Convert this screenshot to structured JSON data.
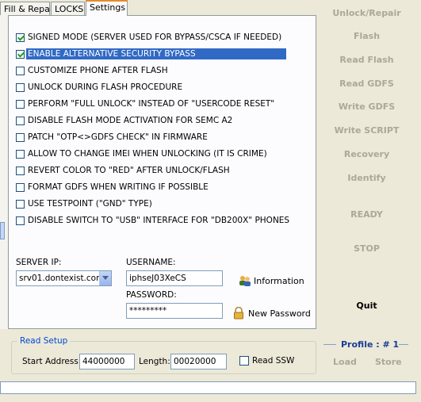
{
  "tabs": [
    {
      "label": "Fill & Repair",
      "active": false
    },
    {
      "label": "LOCKS",
      "active": false
    },
    {
      "label": "Settings",
      "active": true
    }
  ],
  "options": [
    {
      "label": "SIGNED MODE (SERVER USED FOR BYPASS/CSCA IF NEEDED)",
      "checked": true,
      "selected": false
    },
    {
      "label": "ENABLE ALTERNATIVE SECURITY BYPASS",
      "checked": true,
      "selected": true
    },
    {
      "label": "CUSTOMIZE PHONE AFTER FLASH",
      "checked": false,
      "selected": false
    },
    {
      "label": "UNLOCK DURING FLASH PROCEDURE",
      "checked": false,
      "selected": false
    },
    {
      "label": "PERFORM \"FULL UNLOCK\" INSTEAD OF \"USERCODE RESET\"",
      "checked": false,
      "selected": false
    },
    {
      "label": "DISABLE FLASH MODE ACTIVATION FOR SEMC A2",
      "checked": false,
      "selected": false
    },
    {
      "label": "PATCH \"OTP<>GDFS CHECK\" IN FIRMWARE",
      "checked": false,
      "selected": false
    },
    {
      "label": "ALLOW TO CHANGE IMEI WHEN UNLOCKING (IT IS CRIME)",
      "checked": false,
      "selected": false
    },
    {
      "label": "REVERT COLOR TO \"RED\" AFTER UNLOCK/FLASH",
      "checked": false,
      "selected": false
    },
    {
      "label": "FORMAT GDFS WHEN WRITING IF POSSIBLE",
      "checked": false,
      "selected": false
    },
    {
      "label": "USE TESTPOINT (\"GND\" TYPE)",
      "checked": false,
      "selected": false
    },
    {
      "label": "DISABLE SWITCH TO \"USB\" INTERFACE FOR \"DB200X\" PHONES",
      "checked": false,
      "selected": false
    }
  ],
  "server": {
    "label": "SERVER IP:",
    "value": "srv01.dontexist.com"
  },
  "username": {
    "label": "USERNAME:",
    "value": "iphseJ03XeCS"
  },
  "password": {
    "label": "PASSWORD:",
    "value": "*********"
  },
  "links": {
    "information": "Information",
    "new_password": "New Password"
  },
  "side_buttons": {
    "unlock_repair": "Unlock/Repair",
    "flash": "Flash",
    "read_flash": "Read Flash",
    "read_gdfs": "Read GDFS",
    "write_gdfs": "Write GDFS",
    "write_script": "Write SCRIPT",
    "recovery": "Recovery",
    "identify": "Identify",
    "ready": "READY",
    "stop": "STOP",
    "quit": "Quit"
  },
  "profile": {
    "label": "Profile : # 1",
    "load": "Load",
    "store": "Store"
  },
  "read_setup": {
    "title": "Read Setup",
    "start_label": "Start Address:",
    "start_value": "44000000",
    "length_label": "Length:",
    "length_value": "00020000",
    "read_ssw_label": "Read SSW",
    "read_ssw_checked": false
  },
  "colors": {
    "selection": "#316ac5",
    "disabled_text": "#aca899",
    "group_title": "#0046d5",
    "tab_accent": "#e68b2c"
  }
}
